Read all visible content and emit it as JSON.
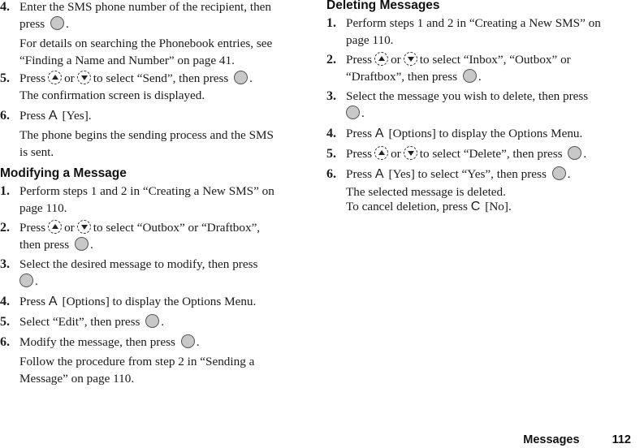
{
  "left": {
    "steps_top": [
      {
        "num": "4.",
        "parts": [
          "Enter the SMS phone number of the recipient, then",
          "press"
        ],
        "end": "."
      },
      {
        "note": [
          "For details on searching the Phonebook entries, see",
          "“Finding a Name and Number” on page 41."
        ]
      },
      {
        "num": "5.",
        "a": "Press",
        "b": "or",
        "c": "to select “Send”, then press",
        "d": ".",
        "e": "The confirmation screen is displayed."
      },
      {
        "num": "6.",
        "a": "Press",
        "key": "A",
        "b": "[Yes]."
      },
      {
        "note": [
          "The phone begins the sending process and the SMS",
          "is sent."
        ]
      }
    ],
    "modify": {
      "heading": "Modifying a Message",
      "s1": {
        "num": "1.",
        "l1": "Perform steps 1 and 2 in “Creating a New SMS” on",
        "l2": "page 110."
      },
      "s2": {
        "num": "2.",
        "a": "Press",
        "b": "or",
        "c": "to select “Outbox” or “Draftbox”,",
        "d": "then press",
        "e": "."
      },
      "s3": {
        "num": "3.",
        "a": "Select the desired message to modify, then press",
        "e": "."
      },
      "s4": {
        "num": "4.",
        "a": "Press",
        "key": "A",
        "b": "[Options] to display the Options Menu."
      },
      "s5": {
        "num": "5.",
        "a": "Select “Edit”, then press",
        "e": "."
      },
      "s6": {
        "num": "6.",
        "a": "Modify the message, then press",
        "e": "."
      },
      "note": [
        "Follow the procedure from step 2 in “Sending a",
        "Message” on page 110."
      ]
    }
  },
  "right": {
    "heading": "Deleting Messages",
    "s1": {
      "num": "1.",
      "l1": "Perform steps 1 and 2 in “Creating a New SMS” on",
      "l2": "page 110."
    },
    "s2": {
      "num": "2.",
      "a": "Press",
      "b": "or",
      "c": "to select “Inbox”, “Outbox” or",
      "d": "“Draftbox”, then press",
      "e": "."
    },
    "s3": {
      "num": "3.",
      "a": "Select the message you wish to delete, then press",
      "e": "."
    },
    "s4": {
      "num": "4.",
      "a": "Press",
      "key": "A",
      "b": "[Options] to display the Options Menu."
    },
    "s5": {
      "num": "5.",
      "a": "Press",
      "b": "or",
      "c": "to select “Delete”, then press",
      "e": "."
    },
    "s6": {
      "num": "6.",
      "a": "Press",
      "key": "A",
      "b": "[Yes] to select “Yes”, then press",
      "e": "."
    },
    "note1": "The selected message is deleted.",
    "note2a": "To cancel deletion, press",
    "note2key": "C",
    "note2b": "[No]."
  },
  "footer": {
    "section": "Messages",
    "page": "112"
  }
}
